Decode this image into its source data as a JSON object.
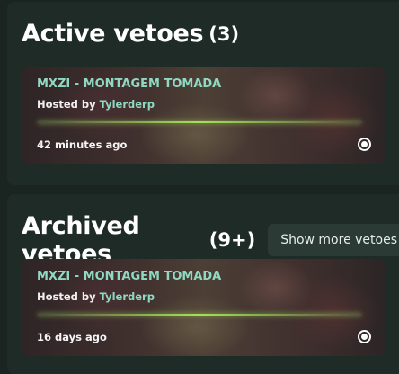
{
  "active": {
    "title": "Active vetoes",
    "count": "(3)",
    "card": {
      "title": "MXZI - MONTAGEM TOMADA",
      "hosted_prefix": "Hosted by ",
      "host": "Tylerderp",
      "time": "42 minutes ago",
      "progress": 1.0
    }
  },
  "archived": {
    "title": "Archived vetoes",
    "count": "(9+)",
    "show_more_label": "Show more vetoes",
    "card": {
      "title": "MXZI - MONTAGEM TOMADA",
      "hosted_prefix": "Hosted by ",
      "host": "Tylerderp",
      "time": "16 days ago",
      "progress": 1.0
    }
  },
  "colors": {
    "accent": "#8fd9c3",
    "progress": "#a6e05a",
    "panel_bg": "#1f2b27",
    "page_bg": "#1a2521"
  },
  "icons": {
    "status": "radio-selected-icon"
  }
}
